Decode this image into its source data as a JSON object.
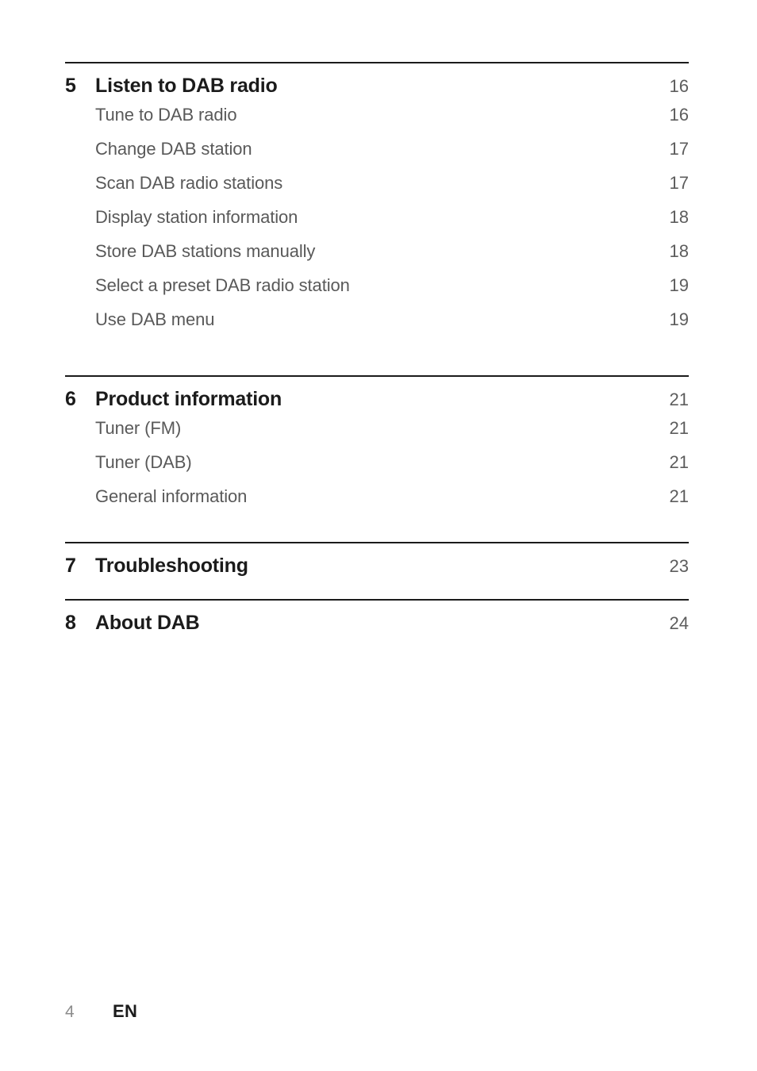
{
  "document": {
    "type": "table-of-contents",
    "page_label": "4",
    "language_code": "EN"
  },
  "sections": [
    {
      "number": "5",
      "title": "Listen to DAB radio",
      "page": "16",
      "entries": [
        {
          "title": "Tune to DAB radio",
          "page": "16"
        },
        {
          "title": "Change DAB station",
          "page": "17"
        },
        {
          "title": "Scan DAB radio stations",
          "page": "17"
        },
        {
          "title": "Display station information",
          "page": "18"
        },
        {
          "title": "Store DAB stations manually",
          "page": "18"
        },
        {
          "title": "Select a preset DAB radio station",
          "page": "19"
        },
        {
          "title": "Use DAB menu",
          "page": "19"
        }
      ]
    },
    {
      "number": "6",
      "title": "Product information",
      "page": "21",
      "entries": [
        {
          "title": "Tuner (FM)",
          "page": "21"
        },
        {
          "title": "Tuner (DAB)",
          "page": "21"
        },
        {
          "title": "General information",
          "page": "21"
        }
      ]
    },
    {
      "number": "7",
      "title": "Troubleshooting",
      "page": "23",
      "entries": []
    },
    {
      "number": "8",
      "title": "About DAB",
      "page": "24",
      "entries": []
    }
  ],
  "colors": {
    "heading": "#1b1b1b",
    "body": "#595959",
    "page_number": "#5d5d5d",
    "rule": "#1b1b1b",
    "footer_number": "#8c8c8c",
    "background": "#ffffff"
  }
}
